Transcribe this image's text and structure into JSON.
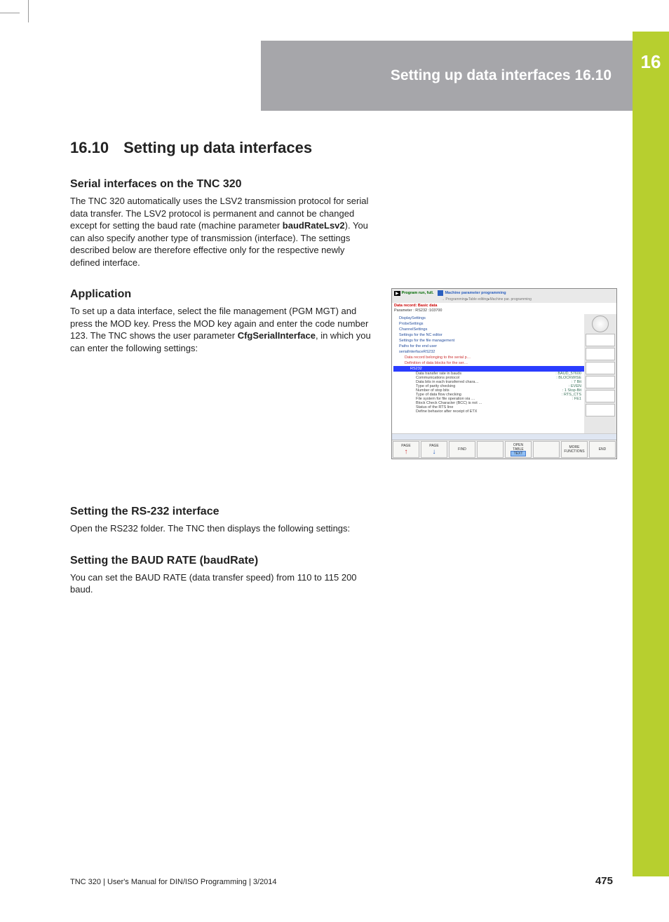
{
  "chapter_badge": "16",
  "header": {
    "running_title": "Setting up data interfaces  16.10"
  },
  "section": {
    "number": "16.10",
    "title": "Setting up data interfaces",
    "h_serial": "Serial interfaces on the TNC 320",
    "p_serial_1": "The TNC 320 automatically uses the LSV2 transmission protocol for serial data transfer. The LSV2 protocol is permanent and cannot be changed except for setting the baud rate (machine parameter ",
    "bold_baudRateLsv2": "baudRateLsv2",
    "p_serial_2": "). You can also specify another type of transmission (interface). The settings described below are therefore effective only for the respective newly defined interface.",
    "h_app": "Application",
    "p_app_1": "To set up a data interface, select the file management (PGM MGT) and press the MOD key. Press the MOD key again and enter the code number 123. The TNC shows the user parameter ",
    "bold_cfg": "CfgSerialInterface",
    "p_app_2": ", in which you can enter the following settings:",
    "h_rs232": "Setting the RS-232 interface",
    "p_rs232": "Open the RS232 folder. The TNC then displays the following settings:",
    "h_baud": "Setting the BAUD RATE (baudRate)",
    "p_baud": "You can set the BAUD RATE (data transfer speed) from 110 to 115 200 baud."
  },
  "screenshot": {
    "title_left": "Program run, full.",
    "title_right": "Machine parameter programming",
    "subtitle": "→ Programming▸Table editing▸Machine par. programming",
    "info1": "Data record: Basic data",
    "info2": "Parameter : RS232 :103700",
    "folders": [
      "DisplaySettings",
      "ProbeSettings",
      "ChannelSettings",
      "Settings for the NC editor",
      "Settings for the file management",
      "Paths for the end user",
      "serialInterfaceRS232"
    ],
    "sub1": "Data record belonging to the serial p…",
    "sub2": "Definition of data blocks for the ser…",
    "selected": "RS232",
    "leaves": [
      {
        "label": "Data transfer rate in bauds",
        "value": ": BAUD_57600"
      },
      {
        "label": "Communications protocol",
        "value": ": BLOCKWISE"
      },
      {
        "label": "Data bits in each transferred chara…",
        "value": ": 7 Bit"
      },
      {
        "label": "Type of parity checking",
        "value": ": EVEN"
      },
      {
        "label": "Number of stop bits",
        "value": ": 1 Stop-Bit"
      },
      {
        "label": "Type of data flow checking",
        "value": ": RTS_CTS"
      },
      {
        "label": "File system for file operation via …",
        "value": ": FE1"
      },
      {
        "label": "Block Check Character (BCC) is not …",
        "value": ""
      },
      {
        "label": "Status of the RTS line",
        "value": ""
      },
      {
        "label": "Define behavior after receipt of ETX",
        "value": ""
      }
    ],
    "softkeys": {
      "k1": "PAGE",
      "k2": "PAGE",
      "k3": "FIND",
      "k4": "",
      "k5a": "OPEN",
      "k5b": "TABLE",
      "k5c": "TEXT",
      "k6": "",
      "k7": "MORE FUNCTIONS",
      "k8": "END"
    }
  },
  "footer": {
    "left": "TNC 320 | User's Manual for DIN/ISO Programming | 3/2014",
    "page": "475"
  }
}
